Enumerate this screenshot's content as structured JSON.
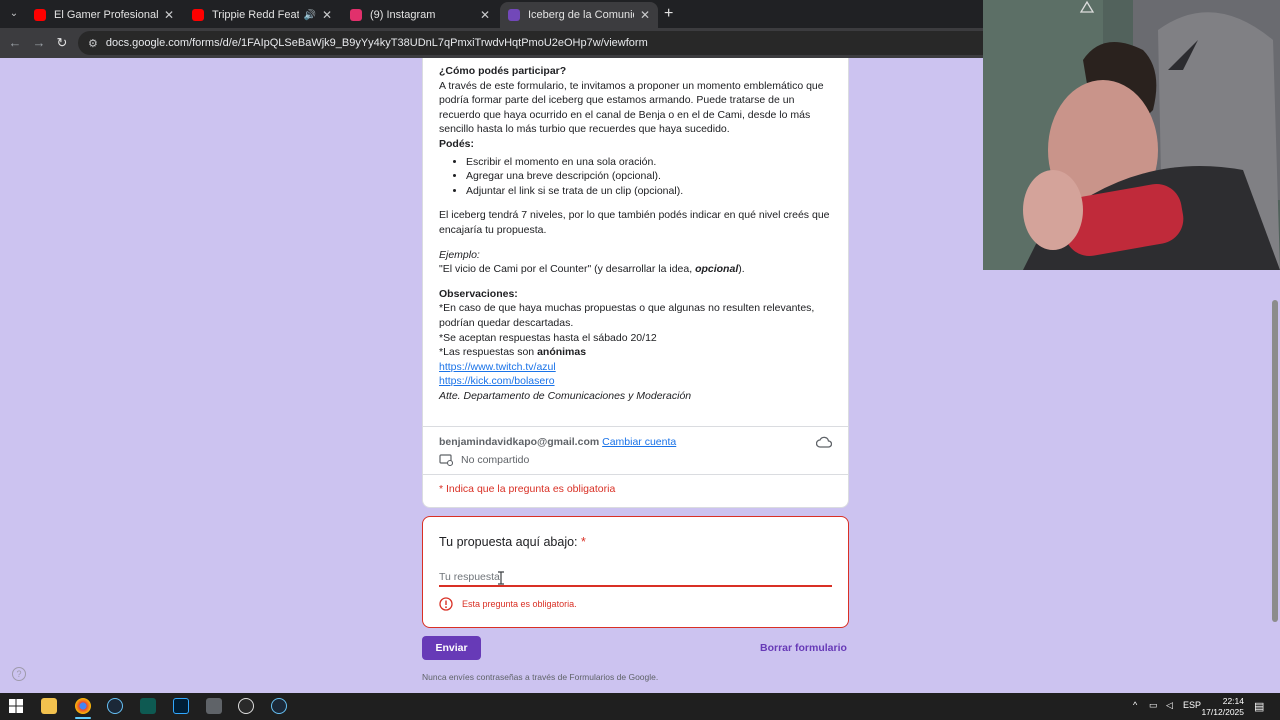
{
  "browser": {
    "tabs": [
      {
        "title": "El Gamer Profesional Que Hizo",
        "favicon": "youtube-icon",
        "active": false
      },
      {
        "title": "Trippie Redd Feat. Tadoe &",
        "favicon": "youtube-icon",
        "active": false
      },
      {
        "title": "(9) Instagram",
        "favicon": "instagram-icon",
        "active": false
      },
      {
        "title": "Iceberg de la Comunidad - Ofic",
        "favicon": "google-forms-icon",
        "active": true
      }
    ],
    "url": "docs.google.com/forms/d/e/1FAIpQLSeBaWjk9_B9yYy4kyT38UDnL7qPmxiTrwdvHqtPmoU2eOHp7w/viewform"
  },
  "form": {
    "description": {
      "how_heading": "¿Cómo podés participar?",
      "intro": "A través de este formulario, te invitamos a proponer un momento emblemático que podría formar parte del iceberg que estamos armando. Puede tratarse de un recuerdo que haya ocurrido en el canal de Benja o en el de Cami, desde lo más sencillo hasta lo más turbio que recuerdes que haya sucedido.",
      "can_heading": "Podés:",
      "can_items": [
        "Escribir el momento en una sola oración.",
        "Agregar una breve descripción (opcional).",
        "Adjuntar el link si se trata de un clip (opcional)."
      ],
      "levels": "El iceberg tendrá 7 niveles, por lo que también podés indicar en qué nivel creés que encajaría tu propuesta.",
      "example_label": "Ejemplo:",
      "example_text": "\"El vicio de Cami por el Counter\" (y desarrollar la idea, ",
      "example_optional": "opcional",
      "example_end": ").",
      "obs_heading": "Observaciones:",
      "obs_1": "*En caso de que haya muchas propuestas o que algunas no resulten relevantes, podrían quedar descartadas.",
      "obs_2": "*Se aceptan respuestas hasta el sábado 20/12",
      "obs_3_prefix": "*Las respuestas son ",
      "obs_3_bold": "anónimas",
      "link_twitch": "https://www.twitch.tv/azul",
      "link_kick": "https://kick.com/bolasero",
      "signature": "Atte. Departamento de Comunicaciones y Moderación"
    },
    "account": {
      "email": "benjamindavidkapo@gmail.com",
      "switch_label": "Cambiar cuenta",
      "shared_label": "No compartido"
    },
    "required_note": "* Indica que la pregunta es obligatoria",
    "question": {
      "title": "Tu propuesta aquí abajo:",
      "required_star": "*",
      "placeholder": "Tu respuesta",
      "error": "Esta pregunta es obligatoria."
    },
    "submit_label": "Enviar",
    "clear_label": "Borrar formulario",
    "footer": "Nunca envíes contraseñas a través de Formularios de Google.",
    "help_label": "?"
  },
  "taskbar": {
    "language": "ESP",
    "time": "22:14",
    "date": "17/12/2025",
    "apps": [
      "windows-start-icon",
      "file-explorer-icon",
      "chrome-icon",
      "steam-icon",
      "terminal-icon",
      "photoshop-icon",
      "calculator-icon",
      "speedometer-app-icon",
      "steam-icon"
    ]
  },
  "colors": {
    "accent": "#673ab7",
    "background": "#ccc3f0",
    "error": "#d93025",
    "link": "#1a73e8"
  }
}
